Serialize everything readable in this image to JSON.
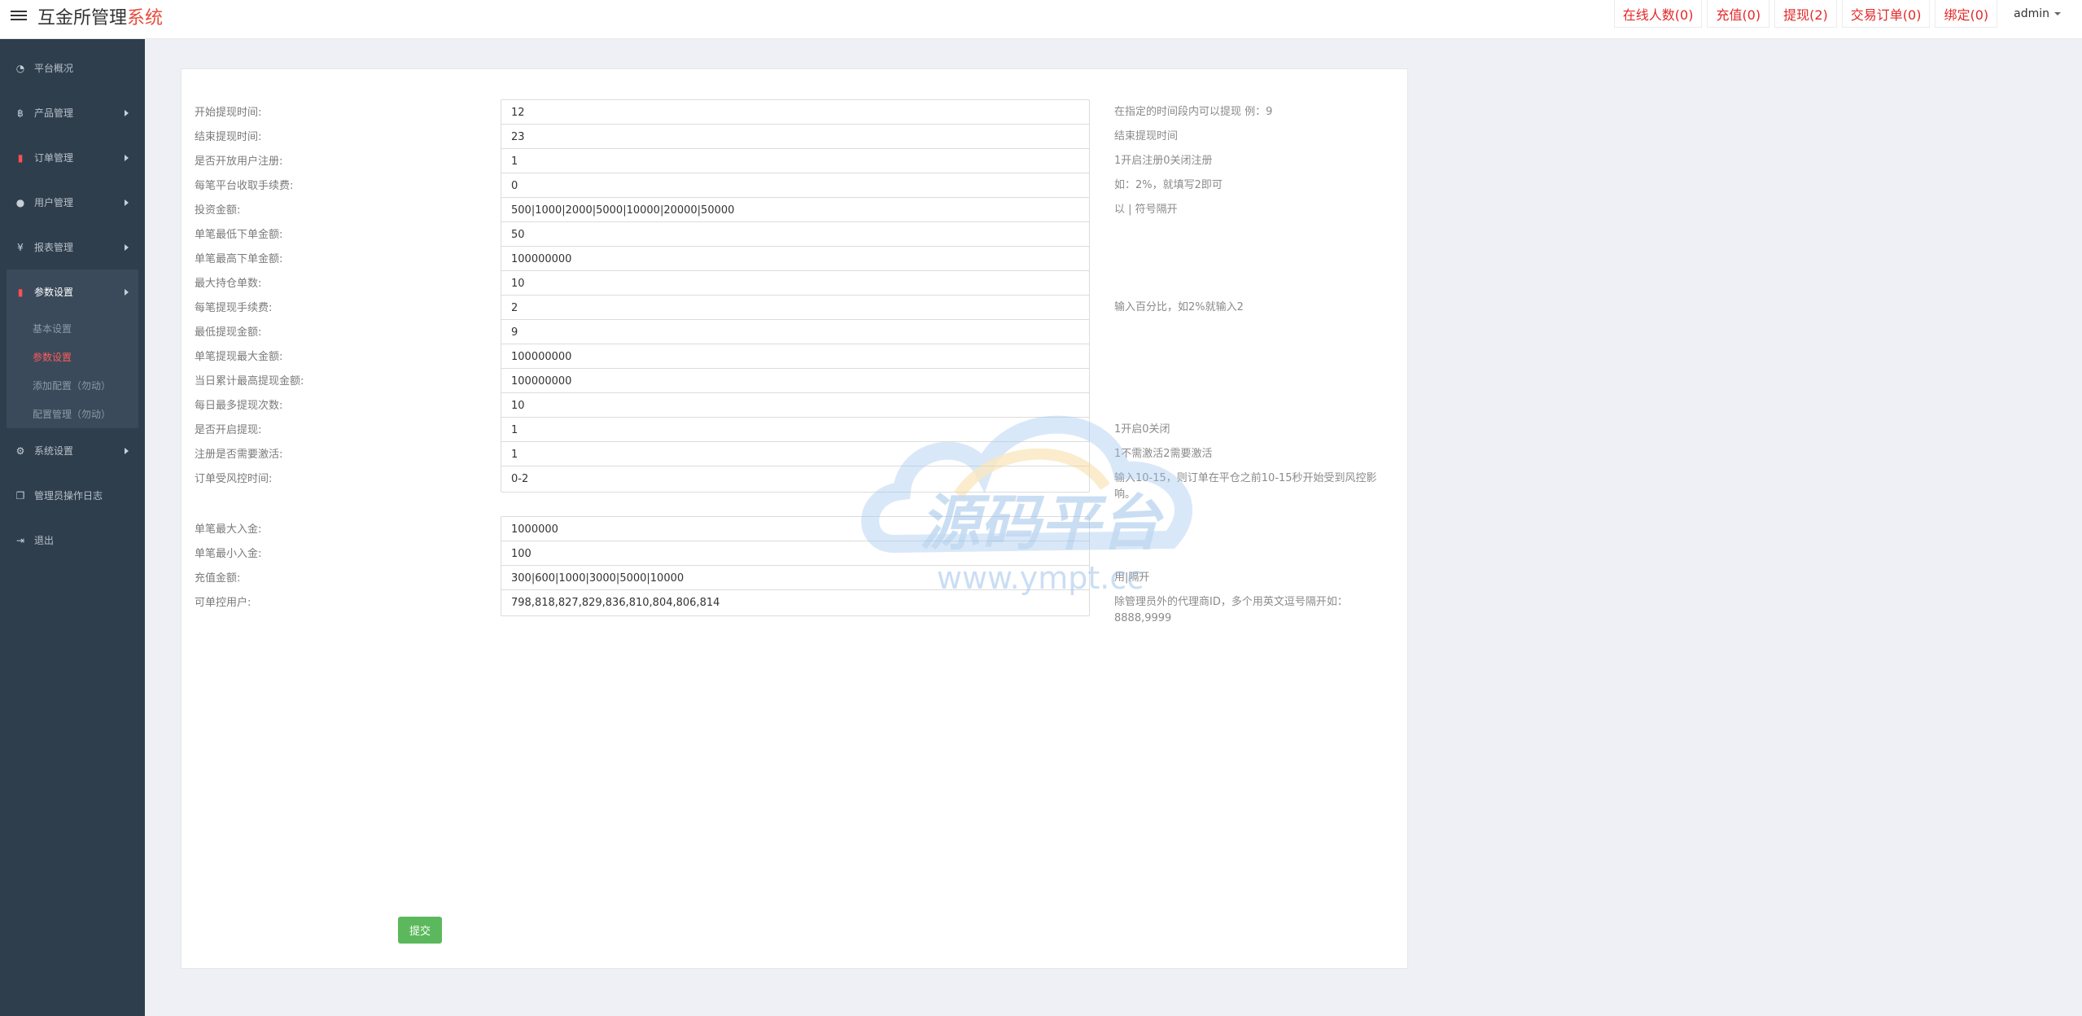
{
  "header": {
    "brand_main": "互金所管理",
    "brand_accent": "系统",
    "links": [
      {
        "label": "在线人数(0)"
      },
      {
        "label": "充值(0)"
      },
      {
        "label": "提现(2)"
      },
      {
        "label": "交易订单(0)"
      },
      {
        "label": "绑定(0)"
      }
    ],
    "user": "admin"
  },
  "sidebar": {
    "items": [
      {
        "label": "平台概况",
        "icon": "dashboard-icon"
      },
      {
        "label": "产品管理",
        "icon": "bitcoin-icon"
      },
      {
        "label": "订单管理",
        "icon": "order-icon"
      },
      {
        "label": "用户管理",
        "icon": "user-icon"
      },
      {
        "label": "报表管理",
        "icon": "yen-icon"
      },
      {
        "label": "参数设置",
        "icon": "settings-doc-icon"
      },
      {
        "label": "系统设置",
        "icon": "gears-icon"
      },
      {
        "label": "管理员操作日志",
        "icon": "log-icon"
      },
      {
        "label": "退出",
        "icon": "logout-icon"
      }
    ],
    "sub_items": [
      {
        "label": "基本设置"
      },
      {
        "label": "参数设置"
      },
      {
        "label": "添加配置（勿动）"
      },
      {
        "label": "配置管理（勿动）"
      }
    ]
  },
  "form": {
    "rows": [
      {
        "label": "开始提现时间:",
        "value": "12",
        "hint": "在指定的时间段内可以提现 例：9"
      },
      {
        "label": "结束提现时间:",
        "value": "23",
        "hint": "结束提现时间"
      },
      {
        "label": "是否开放用户注册:",
        "value": "1",
        "hint": "1开启注册0关闭注册"
      },
      {
        "label": "每笔平台收取手续费:",
        "value": "0",
        "hint": "如：2%，就填写2即可"
      },
      {
        "label": "投资金额:",
        "value": "500|1000|2000|5000|10000|20000|50000",
        "hint": "以 | 符号隔开"
      },
      {
        "label": "单笔最低下单金额:",
        "value": "50",
        "hint": ""
      },
      {
        "label": "单笔最高下单金额:",
        "value": "100000000",
        "hint": ""
      },
      {
        "label": "最大持仓单数:",
        "value": "10",
        "hint": ""
      },
      {
        "label": "每笔提现手续费:",
        "value": "2",
        "hint": "输入百分比，如2%就输入2"
      },
      {
        "label": "最低提现金额:",
        "value": "9",
        "hint": ""
      },
      {
        "label": "单笔提现最大金额:",
        "value": "100000000",
        "hint": ""
      },
      {
        "label": "当日累计最高提现金额:",
        "value": "100000000",
        "hint": ""
      },
      {
        "label": "每日最多提现次数:",
        "value": "10",
        "hint": ""
      },
      {
        "label": "是否开启提现:",
        "value": "1",
        "hint": "1开启0关闭"
      },
      {
        "label": "注册是否需要激活:",
        "value": "1",
        "hint": "1不需激活2需要激活"
      },
      {
        "label": "订单受风控时间:",
        "value": "0-2",
        "hint": "输入10-15，则订单在平仓之前10-15秒开始受到风控影响。"
      },
      {
        "label": "单笔最大入金:",
        "value": "1000000",
        "hint": ""
      },
      {
        "label": "单笔最小入金:",
        "value": "100",
        "hint": ""
      },
      {
        "label": "充值金额:",
        "value": "300|600|1000|3000|5000|10000",
        "hint": "用|隔开"
      },
      {
        "label": "可单控用户:",
        "value": "798,818,827,829,836,810,804,806,814",
        "hint": "除管理员外的代理商ID，多个用英文逗号隔开如：8888,9999"
      }
    ],
    "submit_label": "提交"
  },
  "watermark": {
    "title": "源码平台",
    "url": "www.ympt.cc"
  }
}
